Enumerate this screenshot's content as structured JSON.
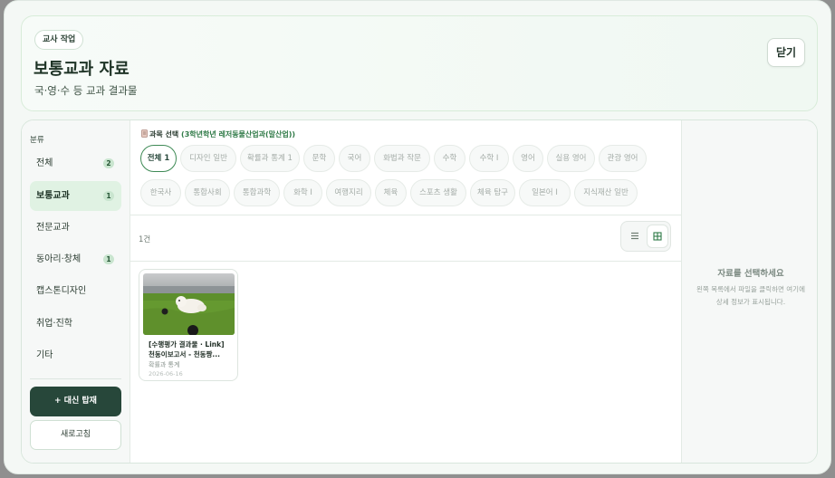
{
  "header": {
    "tag": "교사 작업",
    "title": "보통교과 자료",
    "subtitle": "국·영·수 등 교과 결과물",
    "close_label": "닫기"
  },
  "sidebar": {
    "heading": "분류",
    "items": [
      {
        "label": "전체",
        "badge": "2"
      },
      {
        "label": "보통교과",
        "badge": "1"
      },
      {
        "label": "전문교과",
        "badge": ""
      },
      {
        "label": "동아리·창체",
        "badge": "1"
      },
      {
        "label": "캡스톤디자인",
        "badge": ""
      },
      {
        "label": "취업·진학",
        "badge": ""
      },
      {
        "label": "기타",
        "badge": ""
      }
    ],
    "primary_button": "+ 대신 탑재",
    "secondary_button": "새로고침"
  },
  "main": {
    "subject_prefix": "과목 선택",
    "subject_context": "(3학년학년 레저동물산업과(말산업))",
    "chips": [
      "전체 1",
      "디자인 일반",
      "확률과 통계 1",
      "문학",
      "국어",
      "화법과 작문",
      "수학",
      "수학 I",
      "영어",
      "실용 영어",
      "관광 영어",
      "한국사",
      "통합사회",
      "통합과학",
      "화학 I",
      "여행지리",
      "체육",
      "스포츠 생활",
      "체육 탐구",
      "일본어 I",
      "지식재산 일반"
    ],
    "count": "1건",
    "card": {
      "title": "[수행평가 결과물 · Link] 천동이보고서 - 천동짱...",
      "subject": "확률과 통계",
      "date": "2026-06-16"
    }
  },
  "detail": {
    "title": "자료를 선택하세요",
    "description": "왼쪽 목록에서 파일을 클릭하면 여기에 상세 정보가 표시됩니다."
  }
}
